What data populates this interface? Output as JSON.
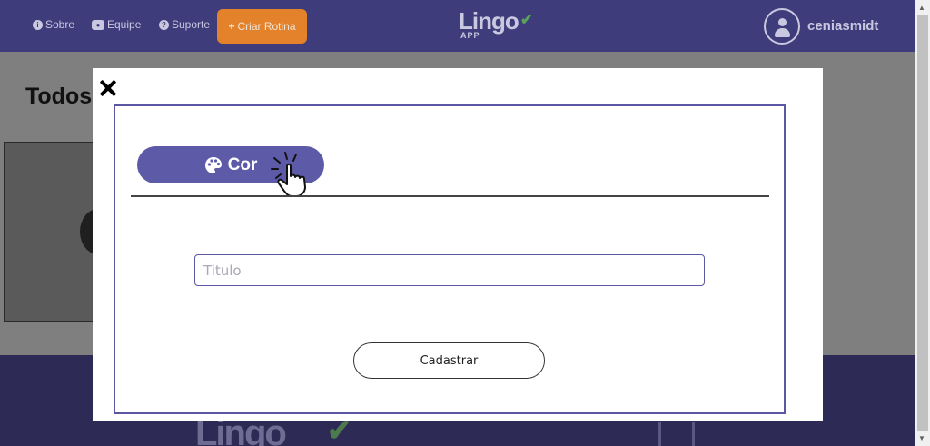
{
  "navbar": {
    "links": [
      {
        "label": "Sobre",
        "icon": "info-icon"
      },
      {
        "label": "Equipe",
        "icon": "users-icon"
      },
      {
        "label": "Suporte",
        "icon": "question-icon"
      }
    ],
    "create_button": {
      "label": "Criar Rotina",
      "icon": "plus-icon"
    },
    "logo": {
      "text": "Lingo",
      "sub": "APP"
    },
    "username": "ceniasmidt",
    "colors": {
      "background": "#3e3c7a",
      "accent": "#e3822b"
    }
  },
  "page": {
    "heading": "Todos"
  },
  "modal": {
    "close_icon": "close-icon",
    "color_button": {
      "label": "Cor",
      "icon": "palette-icon",
      "color": "#5d5aa8"
    },
    "title_input": {
      "placeholder": "Titulo",
      "value": ""
    },
    "submit_button": {
      "label": "Cadastrar"
    }
  }
}
